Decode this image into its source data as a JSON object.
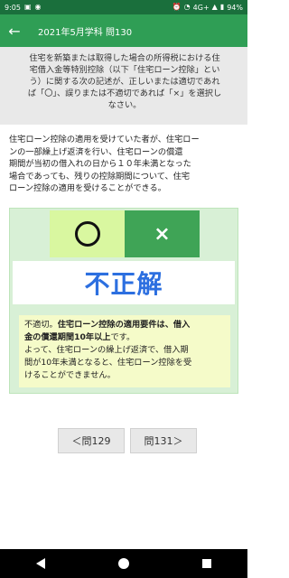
{
  "status_bar": {
    "time": "9:05",
    "network": "4G+",
    "battery": "94%"
  },
  "app_bar": {
    "title": "2021年5月学科 問130"
  },
  "question": {
    "lines": [
      "住宅を新築または取得した場合の所得税における住",
      "宅借入金等特別控除（以下「住宅ローン控除」とい",
      "う）に関する次の記述が、正しいまたは適切であれ",
      "ば「〇」、誤りまたは不適切であれば「×」を選択し",
      "なさい。"
    ]
  },
  "statement": {
    "lines": [
      "住宅ローン控除の適用を受けていた者が、住宅ロー",
      "ンの一部繰上げ返済を行い、住宅ローンの償還",
      "期間が当初の借入れの日から１０年未満となった",
      "場合であっても、残りの控除期間について、住宅",
      "ローン控除の適用を受けることができる。"
    ]
  },
  "choices": {
    "maru": "○",
    "batsu": "×"
  },
  "result": {
    "label": "不正解"
  },
  "explanation": {
    "line1_normal": "不適切。",
    "line1_bold": "住宅ローン控除の適用要件は、借入",
    "line2_bold": "金の償還期間10年以上",
    "line2_normal": "です。",
    "line3": "よって、住宅ローンの繰上げ返済で、借入期",
    "line4": "間が10年未満となると、住宅ローン控除を受",
    "line5": "けることができません。"
  },
  "navigation": {
    "prev_label": "＜問129",
    "next_label": "問131＞"
  },
  "colors": {
    "primary": "#2f9e55",
    "status": "#1a6f3c",
    "result": "#2c6fe0"
  }
}
